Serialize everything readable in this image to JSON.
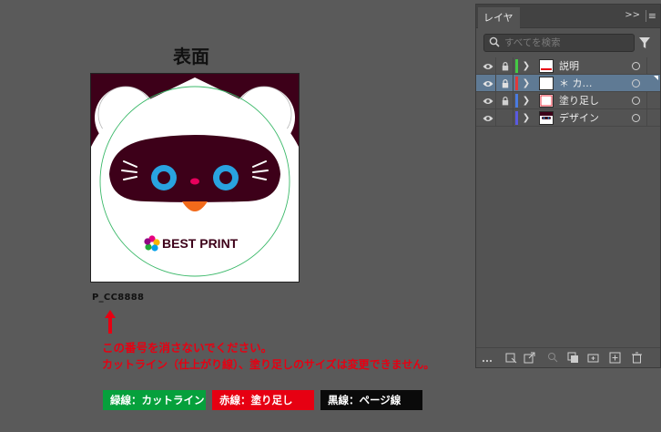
{
  "artboard": {
    "title": "表面",
    "product_code": "P_CC8888",
    "logo_text": "BEST PRINT"
  },
  "notes": {
    "line1": "この番号を消さないでください。",
    "line2": "カットライン（仕上がり線）、塗り足しのサイズは変更できません。"
  },
  "legend": {
    "green": "緑線：カットライン",
    "red": "赤線：塗り足し",
    "black": "黒線：ページ線"
  },
  "layers_panel": {
    "tab_label": "レイヤー",
    "expand_label": ">>",
    "menu_label": "≡",
    "search_placeholder": "すべてを検索",
    "layers": [
      {
        "name": "説明",
        "color": "#45c845",
        "locked": true,
        "selected": false
      },
      {
        "name": "＊ カ…",
        "color": "#e03a3a",
        "locked": true,
        "selected": true
      },
      {
        "name": "塗り足し",
        "color": "#4a7be0",
        "locked": true,
        "selected": false
      },
      {
        "name": "デザイン",
        "color": "#5a5ae0",
        "locked": false,
        "selected": false
      }
    ],
    "footer_icons": [
      "more-icon",
      "collect-export-icon",
      "export-icon",
      "locate-object-icon",
      "clipping-mask-icon",
      "new-sublayer-icon",
      "new-layer-icon",
      "delete-icon"
    ]
  },
  "colors": {
    "cut_line": "#06a03c",
    "bleed_line": "#e60012",
    "page_line": "#0a0a0a",
    "canvas": "#5a5a5a",
    "panel": "#535353"
  }
}
